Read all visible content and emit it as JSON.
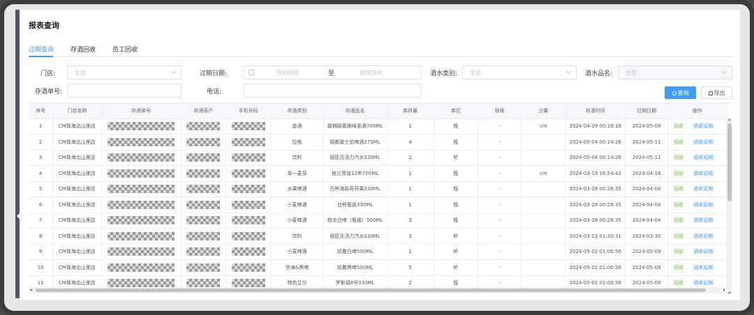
{
  "page_title": "报表查询",
  "tabs": [
    {
      "label": "过期查询",
      "active": true
    },
    {
      "label": "存酒回收",
      "active": false
    },
    {
      "label": "员工回收",
      "active": false
    }
  ],
  "filters": {
    "store_label": "门店:",
    "store_value": "全部",
    "expire_date_label": "过期日期:",
    "start_placeholder": "开始时间",
    "range_sep": "至",
    "end_placeholder": "结束时间",
    "drink_type_label": "酒水类别:",
    "drink_type_value": "全部",
    "drink_name_label": "酒水品名:",
    "drink_name_value": "全部",
    "order_no_label": "存酒单号:",
    "order_no_value": "",
    "phone_label": "电话:",
    "phone_value": ""
  },
  "actions": {
    "query_label": "查询",
    "export_label": "导出"
  },
  "colors": {
    "accent": "#409eff",
    "green": "#67c23a"
  },
  "table": {
    "headers": [
      "序号",
      "门店名称",
      "存酒单号",
      "存酒客户",
      "手机号码",
      "存酒类别",
      "存酒品名",
      "库存量",
      "单位",
      "规格",
      "分量",
      "存酒时间",
      "过期日期",
      "操作"
    ],
    "op_recycle": "回收",
    "op_extend": "酒单延期",
    "rows": [
      {
        "no": "1",
        "store": "CM珠海北山里店",
        "type": "金酒",
        "name": "雄狮路蕉眼味金酒700ML",
        "qty": "1",
        "unit": "瓶",
        "spec": "-",
        "portion": "cm",
        "stored": "2024-04-09 00:16:18",
        "expire": "2024-05-09"
      },
      {
        "no": "2",
        "store": "CM珠海北山里店",
        "type": "拉格",
        "name": "韬都嘉士伯啤酒275ML",
        "qty": "4",
        "unit": "瓶",
        "spec": "-",
        "portion": "",
        "stored": "2024-05-04 00:14:26",
        "expire": "2024-05-11"
      },
      {
        "no": "3",
        "store": "CM珠海北山里店",
        "type": "饮料",
        "name": "屈臣氏汤力汽水330ML",
        "qty": "2",
        "unit": "听",
        "spec": "-",
        "portion": "",
        "stored": "2024-05-04 00:14:26",
        "expire": "2024-05-11"
      },
      {
        "no": "4",
        "store": "CM珠海北山里店",
        "type": "单一麦芽",
        "name": "格兰菲迪12年700ML",
        "qty": "1",
        "unit": "瓶",
        "spec": "-",
        "portion": "cm",
        "stored": "2024-03-19 16:54:42",
        "expire": "2024-04-18"
      },
      {
        "no": "5",
        "store": "CM珠海北山里店",
        "type": "水果啤酒",
        "name": "白熊海盐奇异果330ML",
        "qty": "1",
        "unit": "瓶",
        "spec": "-",
        "portion": "",
        "stored": "2024-03-28 00:26:35",
        "expire": "2024-04-04"
      },
      {
        "no": "6",
        "store": "CM珠海北山里店",
        "type": "小麦啤酒",
        "name": "白熊瓶装330ML",
        "qty": "1",
        "unit": "瓶",
        "spec": "-",
        "portion": "",
        "stored": "2024-03-28 00:26:35",
        "expire": "2024-04-04"
      },
      {
        "no": "7",
        "store": "CM珠海北山里店",
        "type": "小麦啤酒",
        "name": "柏龙白啤（瓶装）500ML",
        "qty": "3",
        "unit": "瓶",
        "spec": "-",
        "portion": "",
        "stored": "2024-03-28 00:26:35",
        "expire": "2024-04-04"
      },
      {
        "no": "8",
        "store": "CM珠海北山里店",
        "type": "饮料",
        "name": "屈臣氏汤力汽水330ML",
        "qty": "3",
        "unit": "听",
        "spec": "-",
        "portion": "",
        "stored": "2024-03-23 01:30:31",
        "expire": "2024-03-30"
      },
      {
        "no": "9",
        "store": "CM珠海北山里店",
        "type": "小麦啤酒",
        "name": "凯撒白啤500ML",
        "qty": "1",
        "unit": "听",
        "spec": "-",
        "portion": "",
        "stored": "2024-05-02 01:00:56",
        "expire": "2024-05-09"
      },
      {
        "no": "10",
        "store": "CM珠海北山里店",
        "type": "世涛&黑啤",
        "name": "凯撒黑啤500ML",
        "qty": "5",
        "unit": "听",
        "spec": "-",
        "portion": "",
        "stored": "2024-05-02 01:00:56",
        "expire": "2024-05-09"
      },
      {
        "no": "11",
        "store": "CM珠海北山里店",
        "type": "特色艾尔",
        "name": "罗斯福8号330ML",
        "qty": "2",
        "unit": "瓶",
        "spec": "-",
        "portion": "",
        "stored": "2024-05-02 01:00:56",
        "expire": "2024-05-09"
      }
    ]
  }
}
